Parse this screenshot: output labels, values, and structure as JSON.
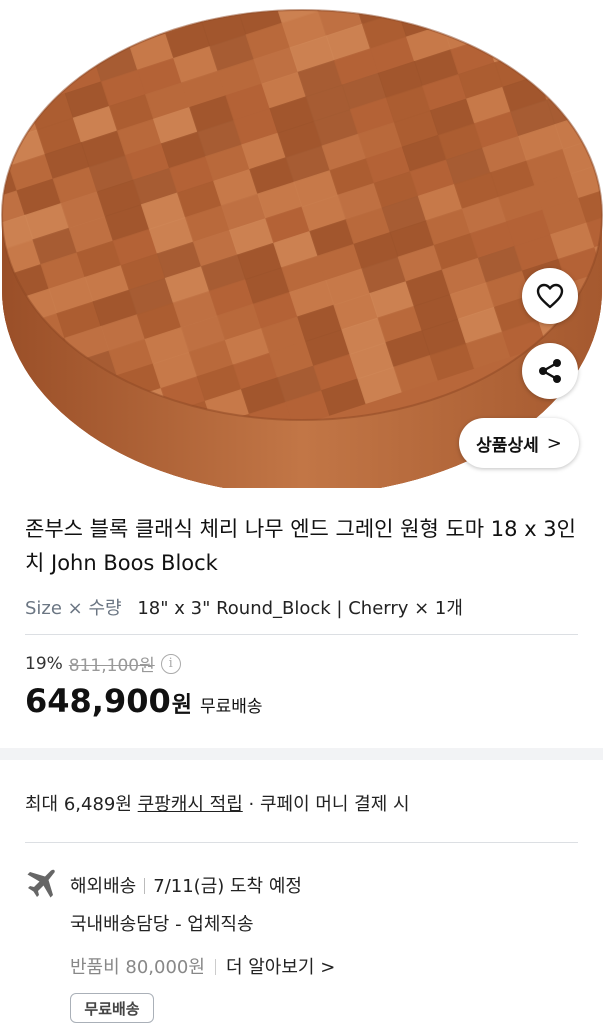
{
  "product": {
    "title": "존부스 블록 클래식 체리 나무 엔드 그레인 원형 도마 18 x 3인치 John Boos Block",
    "detail_button": "상품상세",
    "option_label": "Size × 수량",
    "option_value": "18\" x 3\" Round_Block | Cherry × 1개"
  },
  "price": {
    "discount_pct": "19%",
    "original": "811,100원",
    "sale": "648,900",
    "currency": "원",
    "shipping": "무료배송"
  },
  "reward": {
    "prefix": "최대 6,489원",
    "link": "쿠팡캐시 적립",
    "suffix": "· 쿠페이 머니 결제 시"
  },
  "shipping": {
    "type": "해외배송",
    "arrival": "7/11(금) 도착 예정",
    "handler": "국내배송담당 - 업체직송",
    "return_fee": "반품비 80,000원",
    "learn_more": "더 알아보기 >",
    "badge": "무료배송"
  },
  "icons": {
    "heart": "heart-icon",
    "share": "share-icon",
    "info": "info-icon",
    "plane": "airplane-icon"
  },
  "colors": {
    "wood": "#b8673a",
    "band": "#f2f3f5"
  }
}
